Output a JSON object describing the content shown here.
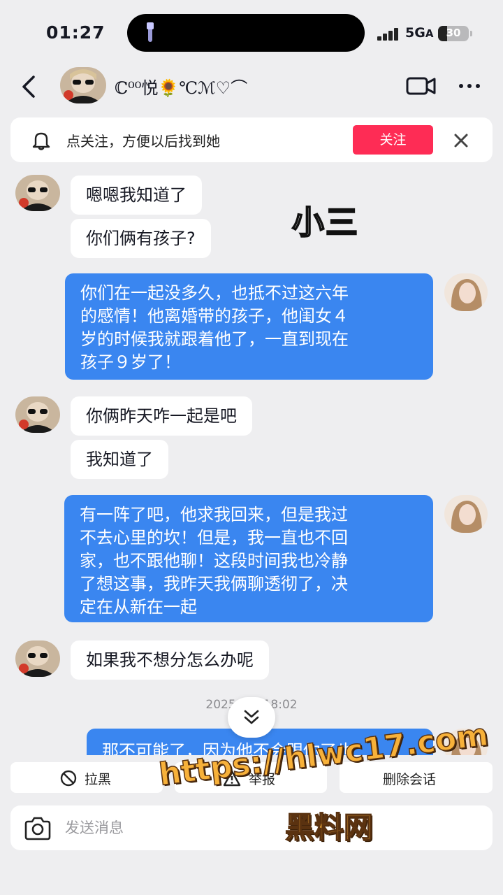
{
  "status_bar": {
    "time": "01:27",
    "network": "5G",
    "network_suffix": "A",
    "battery": "30",
    "battery_level_percent": 30
  },
  "nav": {
    "nickname": "ℂ⁰⁰悦🌻℃ℳ♡⌒",
    "icons": [
      "back-arrow-icon",
      "video-call-icon",
      "more-icon"
    ]
  },
  "follow_banner": {
    "text": "点关注，方便以后找到她",
    "follow_label": "关注",
    "icons": [
      "bell-icon",
      "close-icon"
    ]
  },
  "overlay_tag": "小三",
  "messages": [
    {
      "side": "in",
      "text": "嗯嗯我知道了"
    },
    {
      "side": "in",
      "text": "你们俩有孩子?"
    },
    {
      "side": "out",
      "text": "你们在一起没多久，也抵不过这六年\n的感情！他离婚带的孩子，他闺女４\n岁的时候我就跟着他了，一直到现在\n孩子９岁了！"
    },
    {
      "side": "in",
      "text": "你俩昨天咋一起是吧"
    },
    {
      "side": "in",
      "text": "我知道了"
    },
    {
      "side": "out",
      "text": "有一阵了吧，他求我回来，但是我过\n不去心里的坎！但是，我一直也不回\n家，也不跟他聊！这段时间我也冷静\n了想这事，我昨天我俩聊透彻了，决\n定在从新在一起"
    },
    {
      "side": "in",
      "text": "如果我不想分怎么办呢"
    },
    {
      "side": "out",
      "text": "那不可能了，因为他不会跟你了也"
    }
  ],
  "timestamp": "2025/1… 18:02",
  "actions": {
    "block": "拉黑",
    "report": "举报",
    "delete": "删除会话"
  },
  "composer": {
    "placeholder": "发送消息"
  },
  "watermark": {
    "url": "https://hlwc17.com",
    "name": "黑料网"
  },
  "colors": {
    "follow_button": "#fe2c55",
    "outgoing_bubble": "#3a86f0",
    "background": "#eeeef0"
  }
}
